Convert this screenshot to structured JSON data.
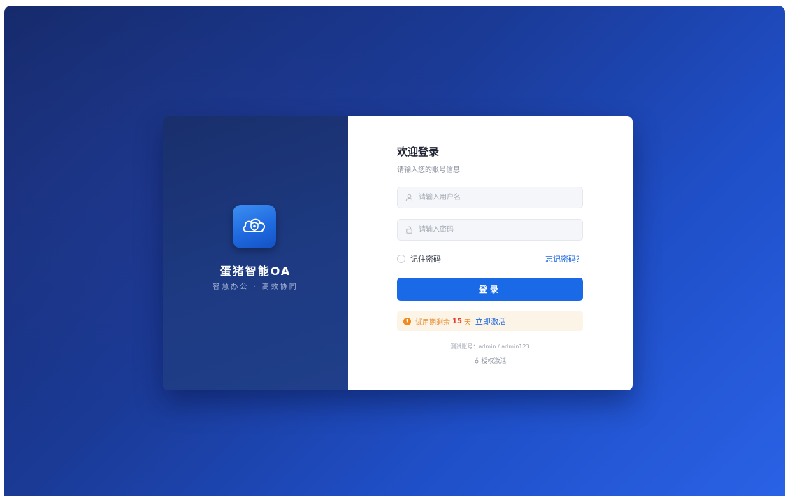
{
  "brand": {
    "name": "蛋猪智能OA",
    "tagline": "智慧办公 · 高效协同",
    "logo_icon": "cloud-shield-icon"
  },
  "login": {
    "title": "欢迎登录",
    "subtitle": "请输入您的账号信息",
    "username_placeholder": "请输入用户名",
    "password_placeholder": "请输入密码",
    "remember_label": "记住密码",
    "forgot_label": "忘记密码？",
    "submit_label": "登录"
  },
  "trial": {
    "prefix": "试用期剩余",
    "days": "15",
    "suffix": "天",
    "activate_label": "立即激活"
  },
  "footer": {
    "test_account": "测试账号：admin / admin123",
    "license_label": "授权激活",
    "license_icon": "key-icon"
  },
  "colors": {
    "primary": "#1a6ae8",
    "warning": "#f08a1c",
    "days_highlight": "#e53a2e"
  }
}
